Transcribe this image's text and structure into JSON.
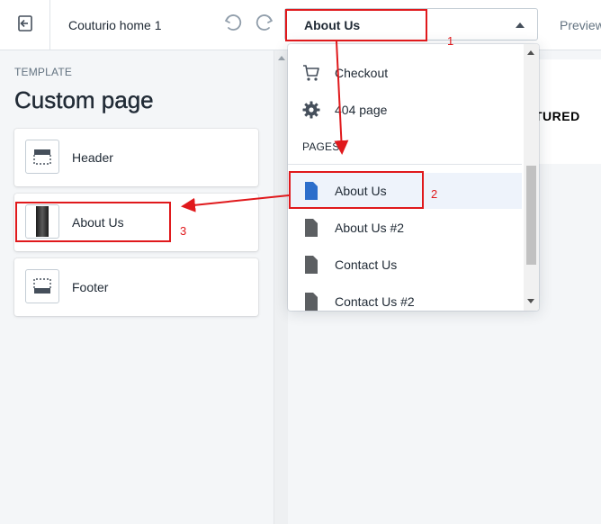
{
  "topbar": {
    "theme_name": "Couturio home 1",
    "selected_page": "About Us",
    "preview_label": "Preview"
  },
  "sidebar": {
    "template_label": "TEMPLATE",
    "title": "Custom page",
    "sections": [
      {
        "label": "Header",
        "icon": "header-section-icon"
      },
      {
        "label": "About Us",
        "icon": "image-thumbnail"
      },
      {
        "label": "Footer",
        "icon": "footer-section-icon"
      }
    ]
  },
  "preview": {
    "featured_text": "TURED"
  },
  "dropdown": {
    "items": [
      {
        "label": "Checkout",
        "icon": "cart-icon"
      },
      {
        "label": "404 page",
        "icon": "gear-icon"
      }
    ],
    "pages_heading": "PAGES",
    "pages": [
      {
        "label": "About Us",
        "icon": "page-icon",
        "selected": true
      },
      {
        "label": "About Us #2",
        "icon": "page-icon",
        "selected": false
      },
      {
        "label": "Contact Us",
        "icon": "page-icon",
        "selected": false
      },
      {
        "label": "Contact Us #2",
        "icon": "page-icon",
        "selected": false
      }
    ]
  },
  "annotations": {
    "step1": "1",
    "step2": "2",
    "step3": "3",
    "color": "#e0191c"
  },
  "colors": {
    "selected_page_icon": "#2c6ecb",
    "page_icon": "#5c5f62",
    "selected_row_bg": "#eef3fb"
  }
}
